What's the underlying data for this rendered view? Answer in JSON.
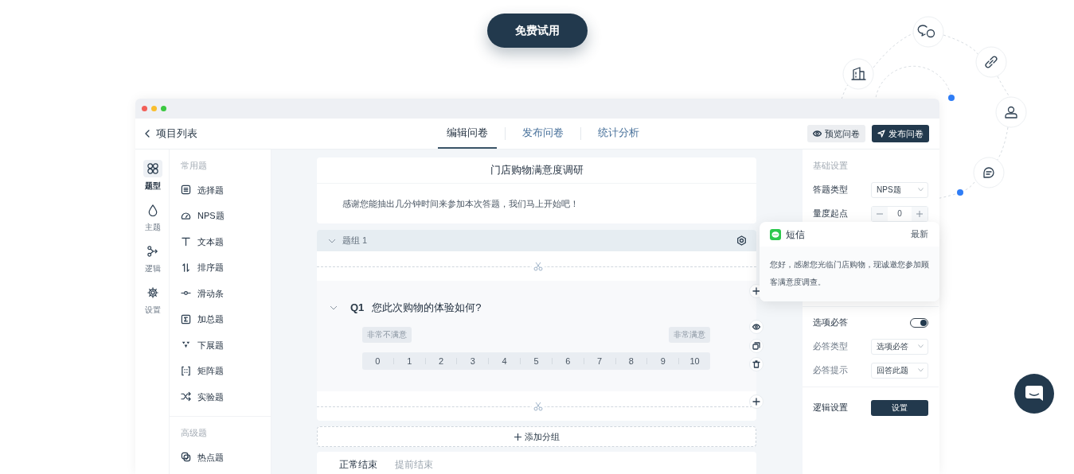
{
  "cta": {
    "label": "免费试用"
  },
  "window": {
    "back_link": "项目列表",
    "tabs": [
      {
        "label": "编辑问卷",
        "selected": true
      },
      {
        "label": "发布问卷",
        "selected": false
      },
      {
        "label": "统计分析",
        "selected": false
      }
    ],
    "actions": [
      {
        "label": "预览问卷",
        "kind": "secondary"
      },
      {
        "label": "发布问卷",
        "kind": "primary"
      }
    ]
  },
  "rail": [
    {
      "label": "题型",
      "selected": true
    },
    {
      "label": "主题",
      "selected": false
    },
    {
      "label": "逻辑",
      "selected": false
    },
    {
      "label": "设置",
      "selected": false
    }
  ],
  "palette": [
    {
      "title": "常用题",
      "items": [
        "选择题",
        "NPS题",
        "文本题",
        "排序题",
        "滑动条",
        "加总题",
        "下展题",
        "矩阵题",
        "实验题"
      ]
    },
    {
      "title": "高级题",
      "items": [
        "热点题"
      ]
    }
  ],
  "survey": {
    "title": "门店购物满意度调研",
    "intro": "感谢您能抽出几分钟时间来参加本次答题，我们马上开始吧！",
    "group": {
      "label": "题组 1",
      "expanded": true
    },
    "question": {
      "number": "Q1",
      "text": "您此次购物的体验如何?",
      "expanded": true,
      "low_label": "非常不满意",
      "high_label": "非常满意",
      "scale": [
        "0",
        "1",
        "2",
        "3",
        "4",
        "5",
        "6",
        "7",
        "8",
        "9",
        "10"
      ]
    },
    "add_group": "添加分组",
    "end_tabs": [
      {
        "label": "正常结束",
        "selected": true
      },
      {
        "label": "提前结束",
        "selected": false
      }
    ]
  },
  "settings": {
    "title": "基础设置",
    "answer_type": {
      "label": "答题类型",
      "value": "NPS题"
    },
    "scale_start": {
      "label": "量度起点",
      "value": "0"
    },
    "required": {
      "label": "选项必答",
      "on": true
    },
    "required_type": {
      "label": "必答类型",
      "value": "选项必答"
    },
    "required_hint": {
      "label": "必答提示",
      "value": "回答此题"
    },
    "logic": {
      "label": "逻辑设置",
      "button": "设置"
    }
  },
  "sms_popup": {
    "title": "短信",
    "time": "最新",
    "message": "您好，感谢您光临门店购物，现诚邀您参加顾客满意度调查。"
  }
}
